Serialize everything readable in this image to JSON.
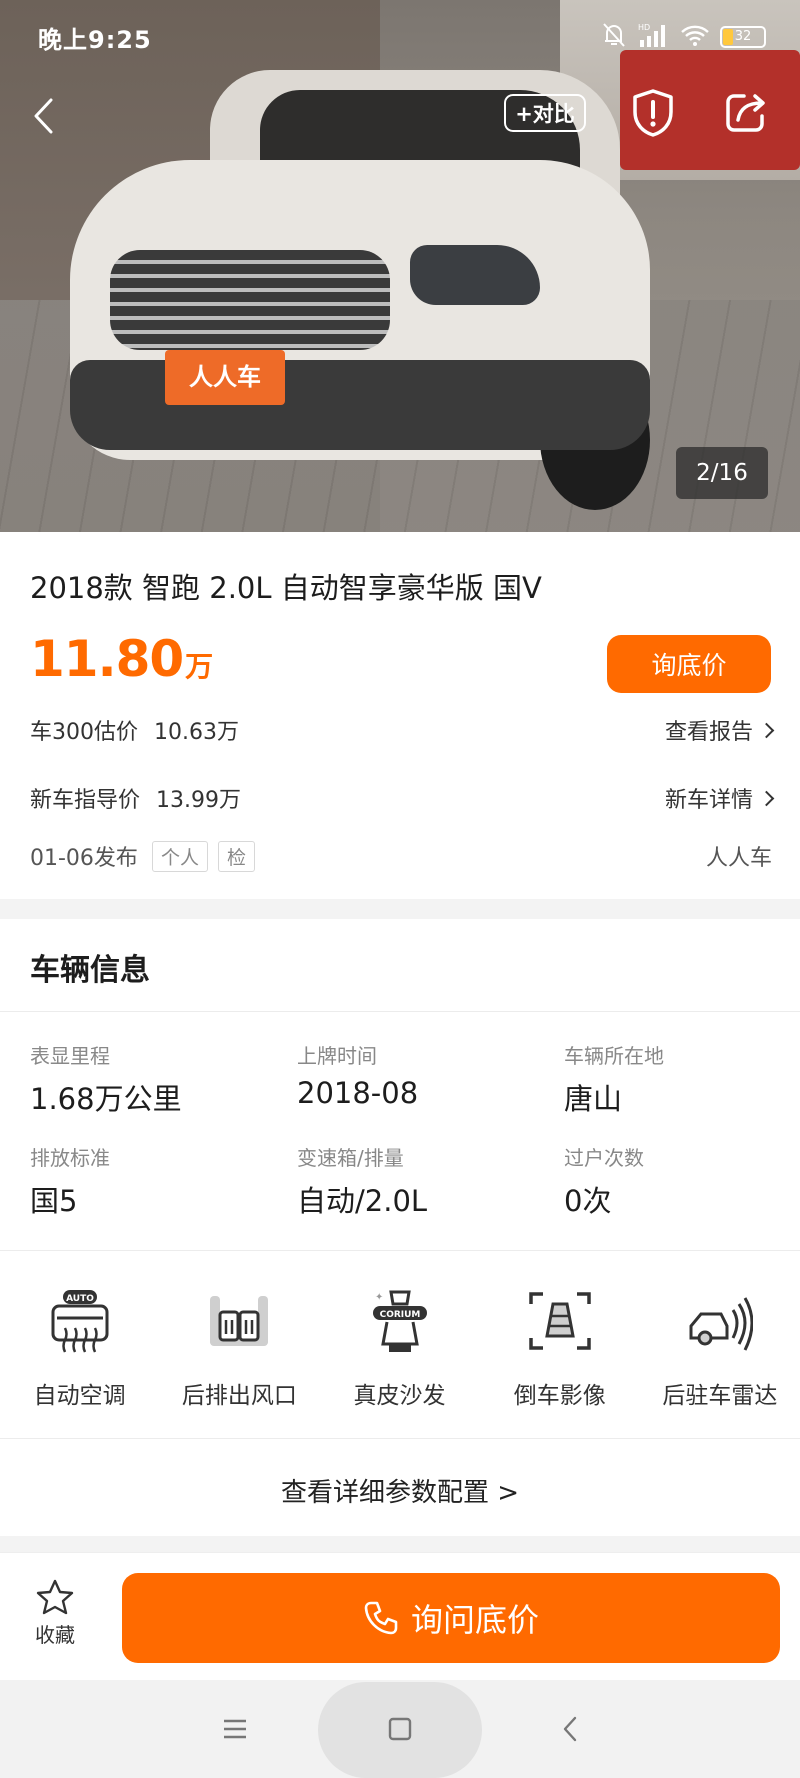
{
  "status_bar": {
    "time": "晚上9:25",
    "battery": "32",
    "network": "HD"
  },
  "nav": {
    "compare_label": "+对比",
    "photo_counter": "2/16"
  },
  "listing": {
    "title": "2018款 智跑 2.0L 自动智享豪华版 国V",
    "price": "11.80",
    "price_unit": "万",
    "ask_price_label": "询底价",
    "estimate_label": "车300估价",
    "estimate_value": "10.63万",
    "report_link": "查看报告",
    "new_price_label": "新车指导价",
    "new_price_value": "13.99万",
    "new_detail_link": "新车详情",
    "published": "01-06发布",
    "tags": [
      "个人",
      "检"
    ],
    "source": "人人车",
    "plate_text": "人人车"
  },
  "vehicle_info": {
    "title": "车辆信息",
    "specs": [
      {
        "label": "表显里程",
        "value": "1.68万公里"
      },
      {
        "label": "上牌时间",
        "value": "2018-08"
      },
      {
        "label": "车辆所在地",
        "value": "唐山"
      },
      {
        "label": "排放标准",
        "value": "国5"
      },
      {
        "label": "变速箱/排量",
        "value": "自动/2.0L"
      },
      {
        "label": "过户次数",
        "value": "0次"
      }
    ],
    "features": [
      {
        "label": "自动空调",
        "icon": "auto-ac-icon",
        "badge": "AUTO"
      },
      {
        "label": "后排出风口",
        "icon": "rear-vent-icon"
      },
      {
        "label": "真皮沙发",
        "icon": "leather-seat-icon",
        "badge": "CORIUM"
      },
      {
        "label": "倒车影像",
        "icon": "reverse-camera-icon"
      },
      {
        "label": "后驻车雷达",
        "icon": "parking-radar-icon"
      }
    ],
    "detail_link": "查看详细参数配置 >"
  },
  "action_bar": {
    "favorite_label": "收藏",
    "call_label": "询问底价"
  },
  "colors": {
    "accent": "#ff6a00",
    "text": "#1d1d1d",
    "muted": "#888888"
  }
}
